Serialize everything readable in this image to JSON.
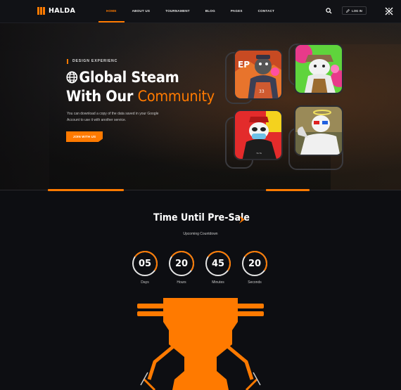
{
  "nav": {
    "logo": "HALDA",
    "menu": [
      "HOME",
      "ABOUT US",
      "TOURNAMENT",
      "BLOG",
      "PAGES",
      "CONTACT"
    ],
    "active_index": 0,
    "login_label": "LOG IN"
  },
  "hero": {
    "eyebrow": "DESIGN EXPERIENC",
    "title_line1": "Global Steam",
    "title_line2_white": "With Our ",
    "title_line2_accent": "Community",
    "description": "You can download a copy of the data saved in your Google Account to use it with another service.",
    "cta": "JOIN WITH US"
  },
  "countdown": {
    "title": "Time Until Pre-Sale",
    "subtitle": "Upcoming Countdown",
    "items": [
      {
        "value": "05",
        "label": "Days"
      },
      {
        "value": "20",
        "label": "Hours"
      },
      {
        "value": "45",
        "label": "Minutes"
      },
      {
        "value": "20",
        "label": "Seconds"
      }
    ]
  },
  "colors": {
    "accent": "#ff7a00",
    "background": "#0d0e12"
  }
}
